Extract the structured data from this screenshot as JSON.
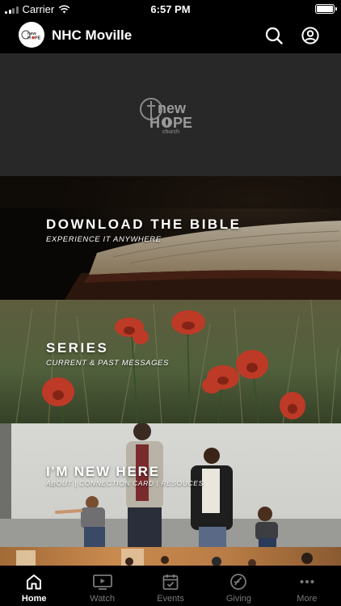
{
  "status_bar": {
    "carrier": "Carrier",
    "time": "6:57 PM"
  },
  "app_bar": {
    "title": "NHC Moville"
  },
  "tiles": {
    "logo": {
      "new": "new",
      "hope_h": "H",
      "hope_pe": "PE",
      "church": "church"
    },
    "bible": {
      "title": "DOWNLOAD THE BIBLE",
      "subtitle": "EXPERIENCE IT ANYWHERE"
    },
    "series": {
      "title": "SERIES",
      "subtitle": "CURRENT & PAST MESSAGES"
    },
    "new_here": {
      "title": "I'M NEW HERE",
      "subtitle": "ABOUT  |  CONNECTION CARD  | RESOUCES"
    }
  },
  "tab_bar": {
    "tabs": [
      {
        "label": "Home",
        "icon": "home-icon",
        "active": true
      },
      {
        "label": "Watch",
        "icon": "watch-icon",
        "active": false
      },
      {
        "label": "Events",
        "icon": "calendar-icon",
        "active": false
      },
      {
        "label": "Giving",
        "icon": "giving-icon",
        "active": false
      },
      {
        "label": "More",
        "icon": "more-icon",
        "active": false
      }
    ]
  },
  "colors": {
    "background": "#000000",
    "active_tab": "#ffffff",
    "inactive_tab": "#7a7a7a"
  }
}
